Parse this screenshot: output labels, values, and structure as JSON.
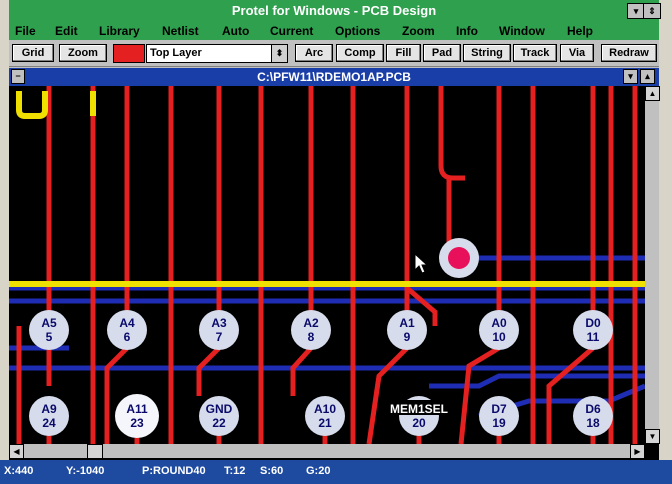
{
  "app": {
    "title": "Protel for Windows - PCB Design"
  },
  "menu": [
    "File",
    "Edit",
    "Library",
    "Netlist",
    "Auto",
    "Current",
    "Options",
    "Zoom",
    "Info",
    "Window",
    "Help"
  ],
  "toolbar": {
    "grid": "Grid",
    "zoom": "Zoom",
    "layer": "Top Layer",
    "arc": "Arc",
    "comp": "Comp",
    "fill": "Fill",
    "pad": "Pad",
    "string": "String",
    "track": "Track",
    "via": "Via",
    "redraw": "Redraw"
  },
  "document": {
    "title": "C:\\PFW11\\RDEMO1AP.PCB"
  },
  "pads_row1": [
    {
      "name": "A5",
      "num": "5"
    },
    {
      "name": "A4",
      "num": "6"
    },
    {
      "name": "A3",
      "num": "7"
    },
    {
      "name": "A2",
      "num": "8"
    },
    {
      "name": "A1",
      "num": "9"
    },
    {
      "name": "A0",
      "num": "10"
    },
    {
      "name": "D0",
      "num": "11"
    }
  ],
  "pads_row2": [
    {
      "name": "A9",
      "num": "24"
    },
    {
      "name": "A11",
      "num": "23"
    },
    {
      "name": "GND",
      "num": "22"
    },
    {
      "name": "A10",
      "num": "21"
    },
    {
      "name": "MEM1SEL",
      "num": "20"
    },
    {
      "name": "D7",
      "num": "19"
    },
    {
      "name": "D6",
      "num": "18"
    }
  ],
  "status": {
    "x": "X:440",
    "y": "Y:-1040",
    "pad": "P:ROUND40",
    "t": "T:12",
    "s": "S:60",
    "g": "G:20"
  },
  "colors": {
    "top_layer": "#e42020",
    "bottom_layer": "#1e2db4",
    "track_yellow": "#f0e000",
    "pad_fill": "#d6dceb",
    "selected_via": "#e8105a"
  }
}
